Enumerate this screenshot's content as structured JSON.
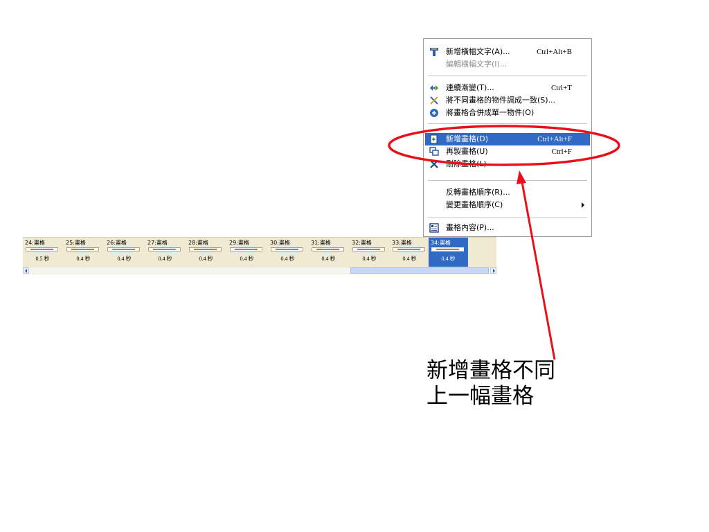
{
  "menu": {
    "items": [
      {
        "icon": "text-banner-icon",
        "label": "新增橫幅文字(A)...",
        "shortcut": "Ctrl+Alt+B",
        "disabled": false,
        "highlight": false
      },
      {
        "icon": "",
        "label": "編輯橫幅文字(I)...",
        "shortcut": "",
        "disabled": true,
        "highlight": false
      },
      {
        "icon": "tween-icon",
        "label": "連續漸變(T)...",
        "shortcut": "Ctrl+T",
        "disabled": false,
        "highlight": false
      },
      {
        "icon": "tools-icon",
        "label": "將不同畫格的物件調成一致(S)...",
        "shortcut": "",
        "disabled": false,
        "highlight": false
      },
      {
        "icon": "merge-icon",
        "label": "將畫格合併成單一物件(O)",
        "shortcut": "",
        "disabled": false,
        "highlight": false
      },
      {
        "icon": "new-frame-icon",
        "label": "新增畫格(D)",
        "shortcut": "Ctrl+Alt+F",
        "disabled": false,
        "highlight": true
      },
      {
        "icon": "duplicate-frame-icon",
        "label": "再製畫格(U)",
        "shortcut": "Ctrl+F",
        "disabled": false,
        "highlight": false
      },
      {
        "icon": "delete-frame-icon",
        "label": "刪除畫格(L)",
        "shortcut": "",
        "disabled": false,
        "highlight": false
      },
      {
        "icon": "",
        "label": "反轉畫格順序(R)...",
        "shortcut": "",
        "disabled": false,
        "highlight": false
      },
      {
        "icon": "",
        "label": "變更畫格順序(C)",
        "shortcut": "",
        "disabled": false,
        "highlight": false,
        "submenu": true
      },
      {
        "icon": "frame-properties-icon",
        "label": "畫格內容(P)...",
        "shortcut": "",
        "disabled": false,
        "highlight": false
      }
    ]
  },
  "frames": [
    {
      "name": "24:畫格",
      "time": "0.5 秒",
      "selected": false
    },
    {
      "name": "25:畫格",
      "time": "0.4 秒",
      "selected": false
    },
    {
      "name": "26:畫格",
      "time": "0.4 秒",
      "selected": false
    },
    {
      "name": "27:畫格",
      "time": "0.4 秒",
      "selected": false
    },
    {
      "name": "28:畫格",
      "time": "0.4 秒",
      "selected": false
    },
    {
      "name": "29:畫格",
      "time": "0.4 秒",
      "selected": false
    },
    {
      "name": "30:畫格",
      "time": "0.4 秒",
      "selected": false
    },
    {
      "name": "31:畫格",
      "time": "0.4 秒",
      "selected": false
    },
    {
      "name": "32:畫格",
      "time": "0.4 秒",
      "selected": false
    },
    {
      "name": "33:畫格",
      "time": "0.4 秒",
      "selected": false
    },
    {
      "name": "34:畫格",
      "time": "0.4 秒",
      "selected": true
    }
  ],
  "annotation": {
    "line1": "新增畫格不同",
    "line2": "上一幅畫格",
    "color": "#e8101a"
  }
}
